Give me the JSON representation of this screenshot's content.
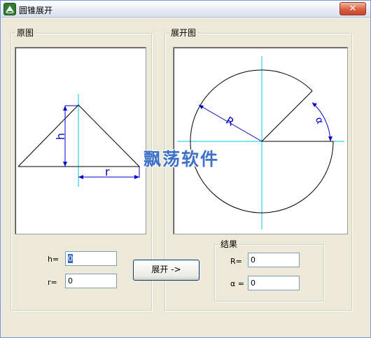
{
  "window": {
    "title": "圆锥展开",
    "close_icon": "close-x-icon"
  },
  "original_panel": {
    "legend": "原图",
    "h_label": "h",
    "r_label": "r",
    "h_input": {
      "label": "h=",
      "value": "0"
    },
    "r_input": {
      "label": "r=",
      "value": "0"
    }
  },
  "unfold_panel": {
    "legend": "展开图",
    "R_label": "R",
    "alpha_label": "α"
  },
  "unfold_button": {
    "label": "展开 ->"
  },
  "result_group": {
    "legend": "结果",
    "R_output": {
      "label": "R=",
      "value": "0"
    },
    "alpha_output": {
      "label": "α =",
      "value": "0"
    }
  },
  "watermark": "飘荡软件",
  "colors": {
    "window_bg": "#ece9d8",
    "drawing_line": "#000000",
    "center_line": "#00c8dc",
    "dimension_line": "#0000c8",
    "selection": "#316ac5"
  }
}
